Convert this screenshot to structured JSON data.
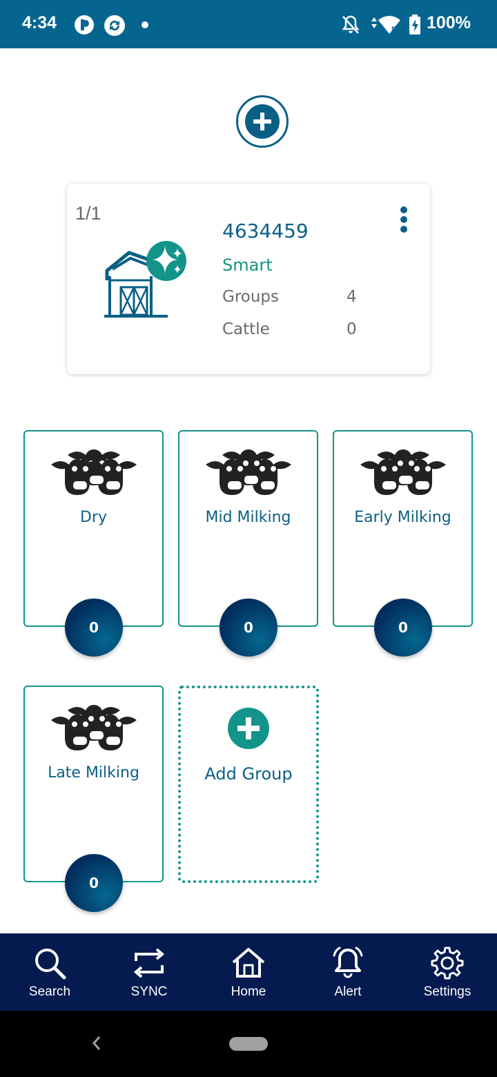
{
  "status_bar": {
    "time": "4:34",
    "battery": "100%",
    "icons": [
      "app-icon-p",
      "app-icon-sync",
      "dot-icon",
      "mute-icon",
      "data-icon",
      "wifi-icon",
      "battery-icon"
    ]
  },
  "farm": {
    "pager": "1/1",
    "id": "4634459",
    "type": "Smart",
    "rows": [
      {
        "label": "Groups",
        "value": "4"
      },
      {
        "label": "Cattle",
        "value": "0"
      }
    ]
  },
  "groups": [
    {
      "name": "Dry",
      "count": "0"
    },
    {
      "name": "Mid Milking",
      "count": "0"
    },
    {
      "name": "Early Milking",
      "count": "0"
    },
    {
      "name": "Late Milking",
      "count": "0"
    }
  ],
  "add_group_label": "Add Group",
  "nav": [
    {
      "label": "Search",
      "icon": "search-icon"
    },
    {
      "label": "SYNC",
      "icon": "sync-icon"
    },
    {
      "label": "Home",
      "icon": "home-icon"
    },
    {
      "label": "Alert",
      "icon": "alert-icon"
    },
    {
      "label": "Settings",
      "icon": "settings-icon"
    }
  ],
  "colors": {
    "status_bar": "#05658f",
    "primary": "#0a5f85",
    "accent": "#13948a",
    "nav_bg": "#051a4f"
  }
}
